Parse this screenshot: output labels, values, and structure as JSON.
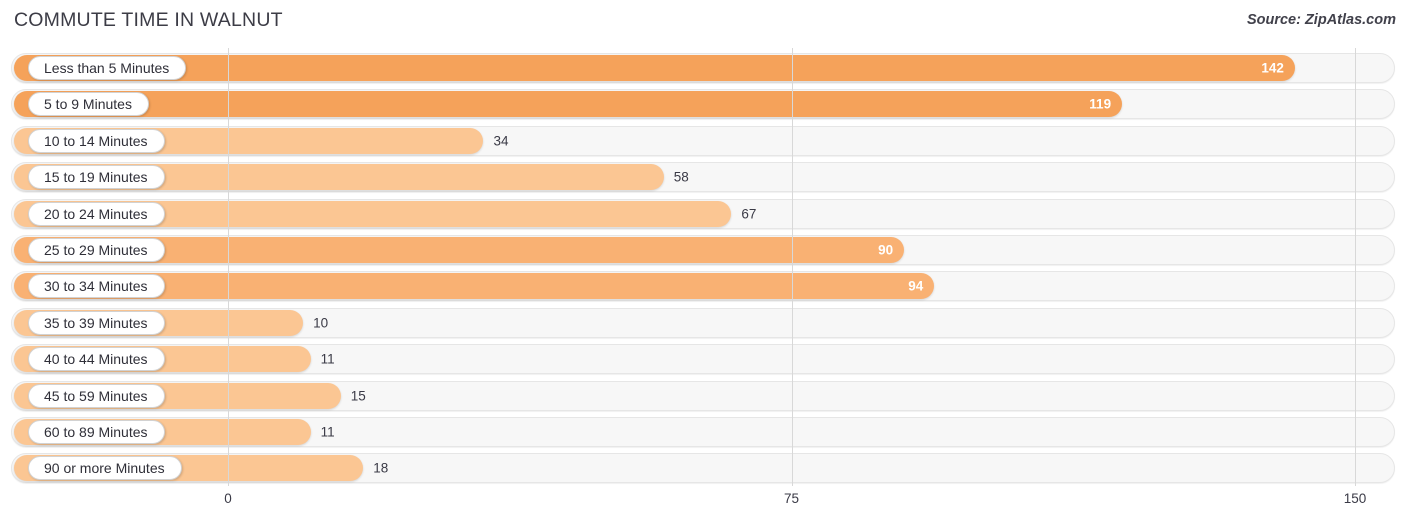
{
  "header": {
    "title": "COMMUTE TIME IN WALNUT",
    "source": "Source: ZipAtlas.com"
  },
  "chart_data": {
    "type": "bar",
    "orientation": "horizontal",
    "title": "COMMUTE TIME IN WALNUT",
    "subtitle": "",
    "xlabel": "",
    "ylabel": "",
    "xlim": [
      0,
      150
    ],
    "ticks": [
      "0",
      "75",
      "150"
    ],
    "tick_values": [
      0,
      75,
      150
    ],
    "grid": true,
    "legend": "none",
    "categories": [
      "Less than 5 Minutes",
      "5 to 9 Minutes",
      "10 to 14 Minutes",
      "15 to 19 Minutes",
      "20 to 24 Minutes",
      "25 to 29 Minutes",
      "30 to 34 Minutes",
      "35 to 39 Minutes",
      "40 to 44 Minutes",
      "45 to 59 Minutes",
      "60 to 89 Minutes",
      "90 or more Minutes"
    ],
    "values": [
      142,
      119,
      34,
      58,
      67,
      90,
      94,
      10,
      11,
      15,
      11,
      18
    ],
    "value_labels": [
      "142",
      "119",
      "34",
      "58",
      "67",
      "90",
      "94",
      "10",
      "11",
      "15",
      "11",
      "18"
    ],
    "bars": [
      {
        "label": "Less than 5 Minutes",
        "value": 142,
        "value_label": "142",
        "color": "#f5a košice"
      },
      {
        "label": "5 to 9 Minutes",
        "value": 119,
        "value_label": "119"
      },
      {
        "label": "10 to 14 Minutes",
        "value": 34,
        "value_label": "34"
      },
      {
        "label": "15 to 19 Minutes",
        "value": 58,
        "value_label": "58"
      },
      {
        "label": "20 to 24 Minutes",
        "value": 67,
        "value_label": "67"
      },
      {
        "label": "25 to 29 Minutes",
        "value": 90,
        "value_label": "90"
      },
      {
        "label": "30 to 34 Minutes",
        "value": 94,
        "value_label": "94"
      },
      {
        "label": "35 to 39 Minutes",
        "value": 10,
        "value_label": "10"
      },
      {
        "label": "40 to 44 Minutes",
        "value": 11,
        "value_label": "11"
      },
      {
        "label": "45 to 59 Minutes",
        "value": 15,
        "value_label": "15"
      },
      {
        "label": "60 to 89 Minutes",
        "value": 11,
        "value_label": "11"
      },
      {
        "label": "90 or more Minutes",
        "value": 18,
        "value_label": "18"
      }
    ],
    "colors": {
      "bar_high": "#f5a25a",
      "bar_mid": "#f9b173",
      "bar_low": "#fbc693",
      "track": "#f7f7f7",
      "track_border": "#e6e6e6",
      "gridline": "#d8d8d8",
      "value_inside": "#ffffff",
      "value_outside": "#3a3a46",
      "title": "#3c3c46"
    }
  }
}
